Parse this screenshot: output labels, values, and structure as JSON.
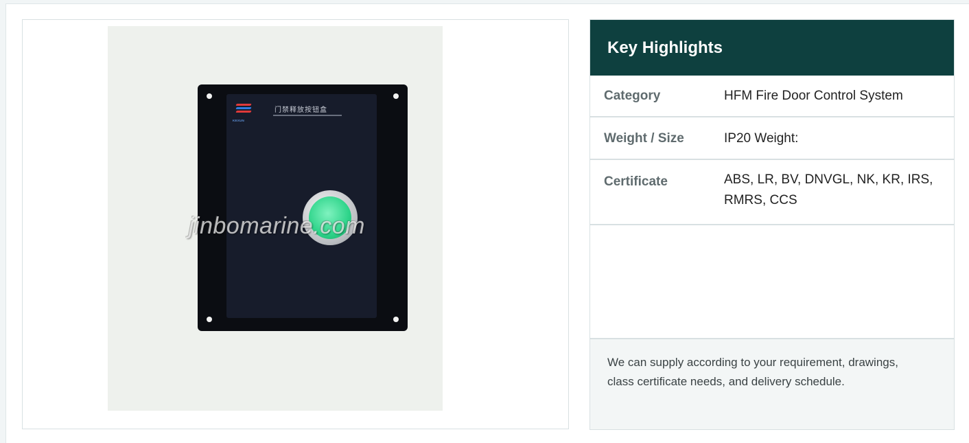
{
  "product_image": {
    "watermark": "jinbomarine.com",
    "logo_text": "KEXUN",
    "label_title": "门禁释放按钮盒",
    "icons": [
      "manufacturer-logo-icon",
      "green-push-button"
    ]
  },
  "highlights": {
    "title": "Key Highlights",
    "rows": [
      {
        "key": "Category",
        "value": "HFM Fire Door Control System"
      },
      {
        "key": "Weight / Size",
        "value": "IP20 Weight:"
      },
      {
        "key": "Certificate",
        "value": "ABS, LR, BV, DNVGL, NK, KR, IRS, RMRS, CCS"
      }
    ],
    "note": "We can supply according to your requirement, drawings, class certificate needs, and delivery schedule."
  },
  "colors": {
    "header_bg": "#0e403f",
    "button_green": "#2ed48a",
    "panel_black": "#0b0d12"
  }
}
